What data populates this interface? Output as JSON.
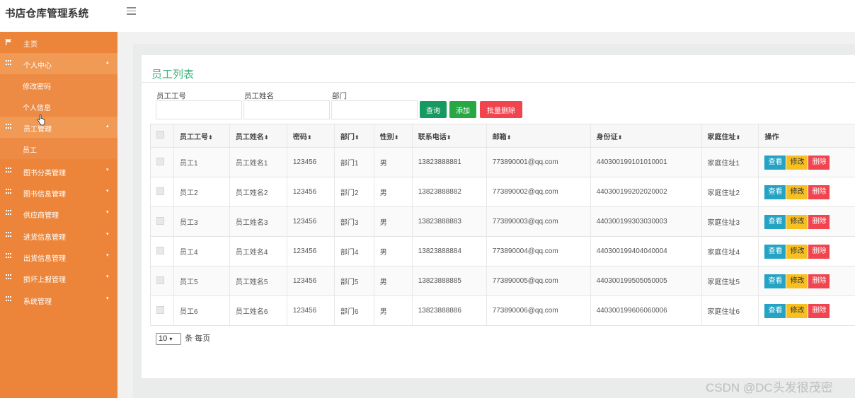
{
  "app": {
    "title": "书店仓库管理系统"
  },
  "sidebar": {
    "home": "主页",
    "personal_center": "个人中心",
    "change_password": "修改密码",
    "personal_info": "个人信息",
    "staff_management": "员工管理",
    "staff": "员工",
    "book_category_management": "图书分类管理",
    "book_info_management": "图书信息管理",
    "supplier_management": "供应商管理",
    "purchase_info_management": "进货信息管理",
    "outbound_info_management": "出货信息管理",
    "damage_report_management": "损坏上报管理",
    "system_management": "系统管理"
  },
  "page": {
    "title": "员工列表",
    "filters": {
      "staff_no_label": "员工工号",
      "staff_name_label": "员工姓名",
      "department_label": "部门"
    },
    "buttons": {
      "search": "查询",
      "add": "添加",
      "batch_delete": "批量删除"
    },
    "columns": [
      "员工工号",
      "员工姓名",
      "密码",
      "部门",
      "性别",
      "联系电话",
      "邮箱",
      "身份证",
      "家庭住址",
      "操作"
    ],
    "row_actions": {
      "view": "查看",
      "edit": "修改",
      "delete": "删除"
    },
    "rows": [
      {
        "staff_no": "员工1",
        "name": "员工姓名1",
        "password": "123456",
        "dept": "部门1",
        "gender": "男",
        "phone": "13823888881",
        "email": "773890001@qq.com",
        "id_card": "440300199101010001",
        "address": "家庭住址1"
      },
      {
        "staff_no": "员工2",
        "name": "员工姓名2",
        "password": "123456",
        "dept": "部门2",
        "gender": "男",
        "phone": "13823888882",
        "email": "773890002@qq.com",
        "id_card": "440300199202020002",
        "address": "家庭住址2"
      },
      {
        "staff_no": "员工3",
        "name": "员工姓名3",
        "password": "123456",
        "dept": "部门3",
        "gender": "男",
        "phone": "13823888883",
        "email": "773890003@qq.com",
        "id_card": "440300199303030003",
        "address": "家庭住址3"
      },
      {
        "staff_no": "员工4",
        "name": "员工姓名4",
        "password": "123456",
        "dept": "部门4",
        "gender": "男",
        "phone": "13823888884",
        "email": "773890004@qq.com",
        "id_card": "440300199404040004",
        "address": "家庭住址4"
      },
      {
        "staff_no": "员工5",
        "name": "员工姓名5",
        "password": "123456",
        "dept": "部门5",
        "gender": "男",
        "phone": "13823888885",
        "email": "773890005@qq.com",
        "id_card": "440300199505050005",
        "address": "家庭住址5"
      },
      {
        "staff_no": "员工6",
        "name": "员工姓名6",
        "password": "123456",
        "dept": "部门6",
        "gender": "男",
        "phone": "13823888886",
        "email": "773890006@qq.com",
        "id_card": "440300199606060006",
        "address": "家庭住址6"
      }
    ],
    "pager": {
      "page_size": "10",
      "suffix": "条 每页"
    }
  },
  "watermark": "CSDN @DC头发很茂密",
  "colors": {
    "sidebar": "#ec853a",
    "title": "#3fb57b",
    "search_button": "#169a62",
    "add_button": "#28a745",
    "batch_delete_button": "#f0444e",
    "view_button": "#24a3c4",
    "edit_button": "#f6c023",
    "delete_button": "#f0444e"
  }
}
